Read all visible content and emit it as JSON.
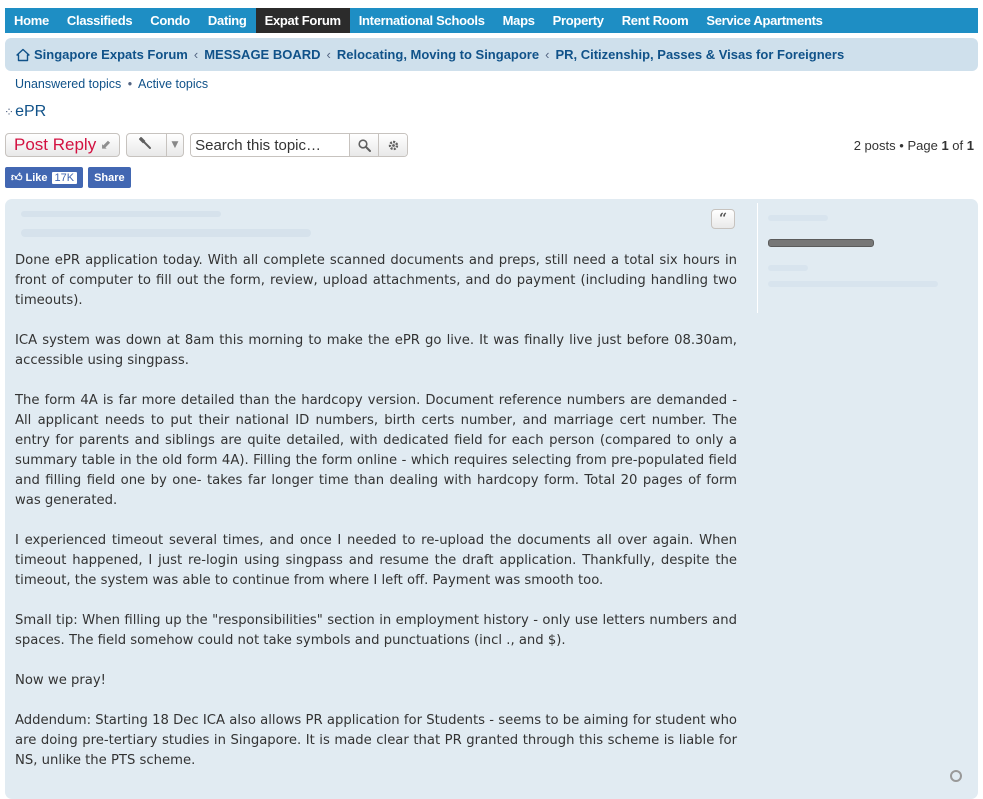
{
  "nav": {
    "items": [
      "Home",
      "Classifieds",
      "Condo",
      "Dating",
      "Expat Forum",
      "International Schools",
      "Maps",
      "Property",
      "Rent Room",
      "Service Apartments"
    ],
    "active": "Expat Forum"
  },
  "breadcrumb": {
    "items": [
      "Singapore Expats Forum",
      "MESSAGE BOARD",
      "Relocating, Moving to Singapore",
      "PR, Citizenship, Passes & Visas for Foreigners"
    ],
    "separator": "‹"
  },
  "quicklinks": {
    "unanswered": "Unanswered topics",
    "active": "Active topics",
    "dot": "•"
  },
  "topic": {
    "title": "ePR"
  },
  "actions": {
    "post_reply": "Post Reply",
    "search_placeholder": "Search this topic…"
  },
  "pagination": {
    "posts": "2 posts",
    "dot": "•",
    "page_word": "Page",
    "current": "1",
    "of_word": "of",
    "total": "1"
  },
  "social": {
    "like_label": "Like",
    "like_count": "17K",
    "share_label": "Share"
  },
  "post": {
    "quote_glyph": "“",
    "paragraphs": [
      "Done ePR application today. With all complete scanned documents and preps, still need a total six hours in front of computer to fill out the form, review, upload attachments, and do payment (including handling two timeouts).",
      "ICA system was down at 8am this morning to make the ePR go live. It was finally live just before 08.30am, accessible using singpass.",
      "The form 4A is far more detailed than the hardcopy version. Document reference numbers are demanded - All applicant needs to put their national ID numbers, birth certs number, and marriage cert number. The entry for parents and siblings are quite detailed, with dedicated field for each person (compared to only a summary table in the old form 4A). Filling the form online - which requires selecting from pre-populated field and filling field one by one- takes far longer time than dealing with hardcopy form. Total 20 pages of form was generated.",
      "I experienced timeout several times, and once I needed to re-upload the documents all over again. When timeout happened, I just re-login using singpass and resume the draft application. Thankfully, despite the timeout, the system was able to continue from where I left off. Payment was smooth too.",
      "Small tip: When filling up the \"responsibilities\" section in employment history - only use letters numbers and spaces. The field somehow could not take symbols and punctuations (incl ., and $).",
      "Now we pray!",
      "Addendum: Starting 18 Dec ICA also allows PR application for Students - seems to be aiming for student who are doing pre-tertiary studies in Singapore. It is made clear that PR granted through this scheme is liable for NS, unlike the PTS scheme."
    ]
  },
  "colors": {
    "nav_bg": "#1e8ec4",
    "nav_active": "#2b2b2b",
    "breadcrumb_bg": "#cfe0ec",
    "link": "#105289",
    "post_bg": "#e1ebf2",
    "post_reply": "#d31141",
    "facebook": "#4267b2"
  }
}
